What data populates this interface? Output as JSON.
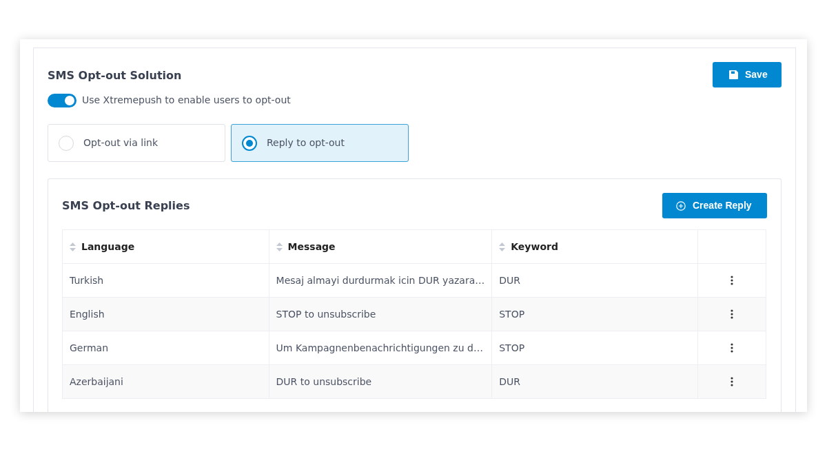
{
  "section": {
    "title": "SMS Opt-out Solution",
    "save_button": "Save"
  },
  "opt_out_toggle": {
    "label": "Use Xtremepush to enable users to opt-out",
    "on": true
  },
  "methods": [
    {
      "label": "Opt-out via link",
      "selected": false
    },
    {
      "label": "Reply to opt-out",
      "selected": true
    }
  ],
  "replies": {
    "title": "SMS Opt-out Replies",
    "create_button": "Create Reply",
    "columns": [
      "Language",
      "Message",
      "Keyword"
    ],
    "rows": [
      {
        "language": "Turkish",
        "message": "Mesaj almayi durdurmak icin DUR yazara…",
        "keyword": "DUR"
      },
      {
        "language": "English",
        "message": "STOP to unsubscribe",
        "keyword": "STOP"
      },
      {
        "language": "German",
        "message": "Um Kampagnenbenachrichtigungen zu d…",
        "keyword": "STOP"
      },
      {
        "language": "Azerbaijani",
        "message": "DUR to unsubscribe",
        "keyword": "DUR"
      }
    ]
  }
}
